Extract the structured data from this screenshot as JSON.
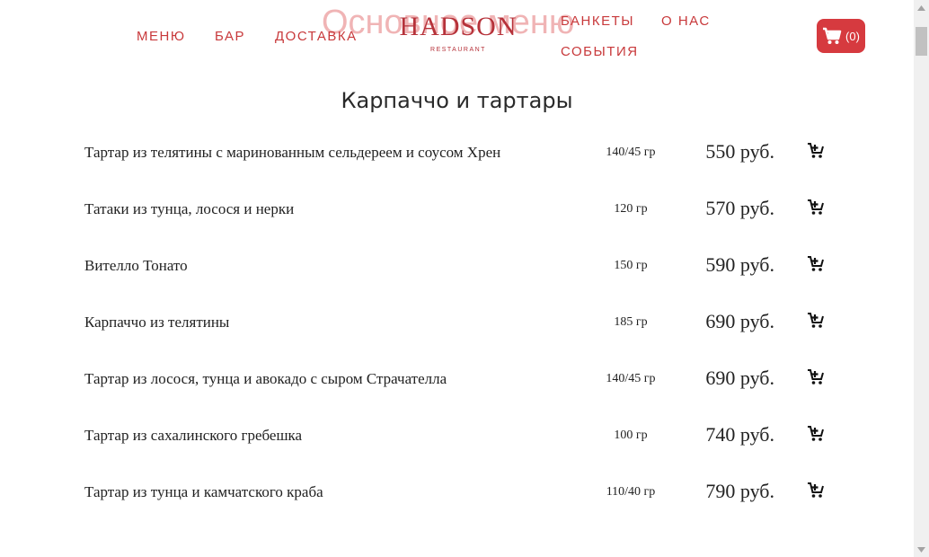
{
  "header": {
    "nav_left": [
      "МЕНЮ",
      "БАР",
      "ДОСТАВКА"
    ],
    "nav_right_top": [
      "БАНКЕТЫ",
      "О НАС"
    ],
    "nav_right_bottom": [
      "СОБЫТИЯ"
    ],
    "watermark": "Основное меню",
    "logo_main": "HADSON",
    "logo_sub": "RESTAURANT",
    "cart_count": "(0)",
    "accent_color": "#c8393b",
    "cart_color": "#d63a3f"
  },
  "section": {
    "title": "Карпаччо и тартары",
    "items": [
      {
        "name": "Тартар из телятины с маринованным сельдереем и соусом Хрен",
        "weight": "140/45 гр",
        "price": "550 руб."
      },
      {
        "name": "Татаки из тунца, лосося и нерки",
        "weight": "120 гр",
        "price": "570 руб."
      },
      {
        "name": "Вителло Тонато",
        "weight": "150 гр",
        "price": "590 руб."
      },
      {
        "name": "Карпаччо из телятины",
        "weight": "185 гр",
        "price": "690 руб."
      },
      {
        "name": "Тартар из лосося, тунца и авокадо с сыром Страчателла",
        "weight": "140/45 гр",
        "price": "690 руб."
      },
      {
        "name": "Тартар из сахалинского гребешка",
        "weight": "100 гр",
        "price": "740 руб."
      },
      {
        "name": "Тартар из тунца и камчатского краба",
        "weight": "110/40 гр",
        "price": "790 руб."
      }
    ]
  },
  "icons": {
    "cart": "cart-icon",
    "add_to_cart": "cart-plus-icon"
  }
}
